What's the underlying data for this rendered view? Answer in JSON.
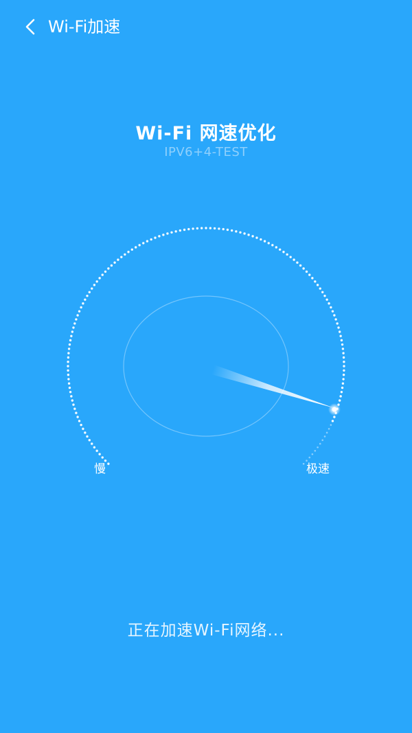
{
  "header": {
    "back_icon": "chevron-left-icon",
    "title": "Wi-Fi加速"
  },
  "main": {
    "title": "Wi-Fi 网速优化",
    "subtitle": "IPV6+4-TEST"
  },
  "gauge": {
    "label_slow": "慢",
    "label_fast": "极速",
    "speed_level": 0.92
  },
  "status": {
    "text": "正在加速Wi-Fi网络..."
  },
  "colors": {
    "background": "#29a7fb",
    "subtitle": "#8fd0fc",
    "text": "#ffffff"
  }
}
